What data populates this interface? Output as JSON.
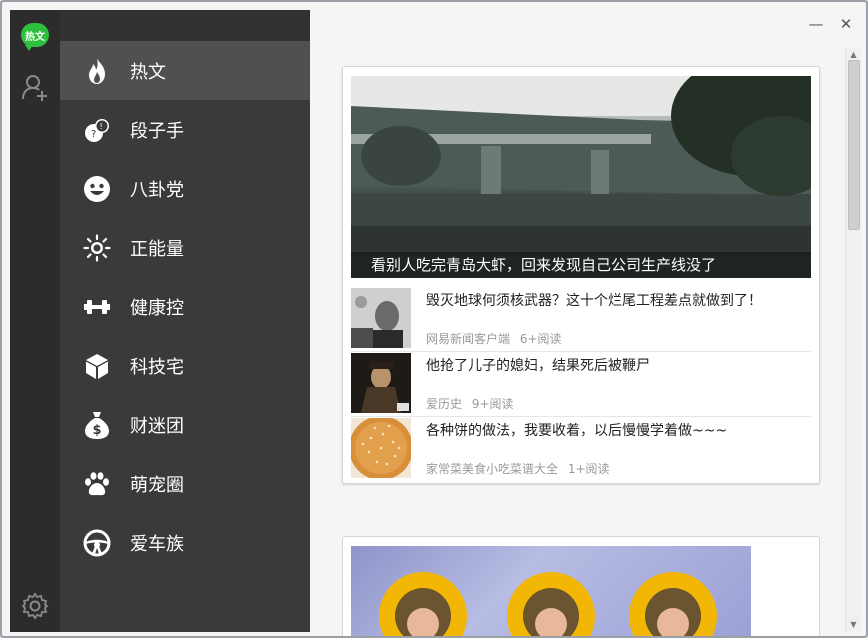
{
  "app": {
    "badge": "热文"
  },
  "sidebar": {
    "items": [
      {
        "label": "热文",
        "icon": "flame-icon",
        "active": true
      },
      {
        "label": "段子手",
        "icon": "speech-bubbles-icon"
      },
      {
        "label": "八卦党",
        "icon": "smiley-icon"
      },
      {
        "label": "正能量",
        "icon": "sun-icon"
      },
      {
        "label": "健康控",
        "icon": "dumbbell-icon"
      },
      {
        "label": "科技宅",
        "icon": "cube-icon"
      },
      {
        "label": "财迷团",
        "icon": "money-bag-icon"
      },
      {
        "label": "萌宠圈",
        "icon": "paw-icon"
      },
      {
        "label": "爱车族",
        "icon": "steering-wheel-icon"
      }
    ]
  },
  "window": {
    "minimize": "—",
    "close": "✕"
  },
  "feed": {
    "hero_caption": "看别人吃完青岛大虾，回来发现自己公司生产线没了",
    "articles": [
      {
        "title": "毁灭地球何须核武器？这十个烂尾工程差点就做到了！",
        "source": "网易新闻客户端",
        "reads": "6+阅读"
      },
      {
        "title": "他抢了儿子的媳妇，结果死后被鞭尸",
        "source": "爱历史",
        "reads": "9+阅读"
      },
      {
        "title": "各种饼的做法，我要收着，以后慢慢学着做~~~",
        "source": "家常菜美食小吃菜谱大全",
        "reads": "1+阅读"
      }
    ]
  },
  "colors": {
    "accent_green": "#2fbf3e",
    "sidebar_bg": "#3a3a3a",
    "sidebar_active": "#505050",
    "rail_bg": "#2c2c2c"
  }
}
